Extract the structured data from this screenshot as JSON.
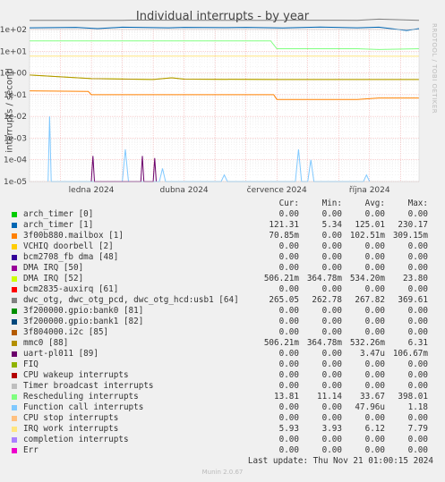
{
  "title": "Individual interrupts - by year",
  "side_note": "RRDTOOL / TOBI OETIKER",
  "footer": "Last update: Thu Nov 21 01:00:15 2024",
  "version": "Munin 2.0.67",
  "legend_headers": [
    "Cur:",
    "Min:",
    "Avg:",
    "Max:"
  ],
  "legend": [
    {
      "name": "arch_timer [0]",
      "color": "#00cc00",
      "cur": "0.00",
      "min": "0.00",
      "avg": "0.00",
      "max": "0.00"
    },
    {
      "name": "arch_timer [1]",
      "color": "#0066b3",
      "cur": "121.31",
      "min": "5.34",
      "avg": "125.01",
      "max": "230.17"
    },
    {
      "name": "3f00b880.mailbox [1]",
      "color": "#ff8000",
      "cur": "70.85m",
      "min": "0.00",
      "avg": "102.51m",
      "max": "309.15m"
    },
    {
      "name": "VCHIQ doorbell [2]",
      "color": "#ffcc00",
      "cur": "0.00",
      "min": "0.00",
      "avg": "0.00",
      "max": "0.00"
    },
    {
      "name": "bcm2708_fb dma [48]",
      "color": "#330099",
      "cur": "0.00",
      "min": "0.00",
      "avg": "0.00",
      "max": "0.00"
    },
    {
      "name": "DMA IRQ [50]",
      "color": "#990099",
      "cur": "0.00",
      "min": "0.00",
      "avg": "0.00",
      "max": "0.00"
    },
    {
      "name": "DMA IRQ [52]",
      "color": "#ccff00",
      "cur": "506.21m",
      "min": "364.78m",
      "avg": "534.20m",
      "max": "23.80"
    },
    {
      "name": "bcm2835-auxirq [61]",
      "color": "#ff0000",
      "cur": "0.00",
      "min": "0.00",
      "avg": "0.00",
      "max": "0.00"
    },
    {
      "name": "dwc_otg, dwc_otg_pcd, dwc_otg_hcd:usb1 [64]",
      "color": "#808080",
      "cur": "265.05",
      "min": "262.78",
      "avg": "267.82",
      "max": "369.61"
    },
    {
      "name": "3f200000.gpio:bank0 [81]",
      "color": "#008f00",
      "cur": "0.00",
      "min": "0.00",
      "avg": "0.00",
      "max": "0.00"
    },
    {
      "name": "3f200000.gpio:bank1 [82]",
      "color": "#00487d",
      "cur": "0.00",
      "min": "0.00",
      "avg": "0.00",
      "max": "0.00"
    },
    {
      "name": "3f804000.i2c [85]",
      "color": "#b35a00",
      "cur": "0.00",
      "min": "0.00",
      "avg": "0.00",
      "max": "0.00"
    },
    {
      "name": "mmc0 [88]",
      "color": "#b38f00",
      "cur": "506.21m",
      "min": "364.78m",
      "avg": "532.26m",
      "max": "6.31"
    },
    {
      "name": "uart-pl011 [89]",
      "color": "#6b006b",
      "cur": "0.00",
      "min": "0.00",
      "avg": "3.47u",
      "max": "106.67m"
    },
    {
      "name": "FIQ",
      "color": "#8fb300",
      "cur": "0.00",
      "min": "0.00",
      "avg": "0.00",
      "max": "0.00"
    },
    {
      "name": "CPU wakeup interrupts",
      "color": "#b30000",
      "cur": "0.00",
      "min": "0.00",
      "avg": "0.00",
      "max": "0.00"
    },
    {
      "name": "Timer broadcast interrupts",
      "color": "#bebebe",
      "cur": "0.00",
      "min": "0.00",
      "avg": "0.00",
      "max": "0.00"
    },
    {
      "name": "Rescheduling interrupts",
      "color": "#80ff80",
      "cur": "13.81",
      "min": "11.14",
      "avg": "33.67",
      "max": "398.01"
    },
    {
      "name": "Function call interrupts",
      "color": "#80c9ff",
      "cur": "0.00",
      "min": "0.00",
      "avg": "47.96u",
      "max": "1.18"
    },
    {
      "name": "CPU stop interrupts",
      "color": "#ffc080",
      "cur": "0.00",
      "min": "0.00",
      "avg": "0.00",
      "max": "0.00"
    },
    {
      "name": "IRQ work interrupts",
      "color": "#ffe680",
      "cur": "5.93",
      "min": "3.93",
      "avg": "6.12",
      "max": "7.79"
    },
    {
      "name": "completion interrupts",
      "color": "#aa80ff",
      "cur": "0.00",
      "min": "0.00",
      "avg": "0.00",
      "max": "0.00"
    },
    {
      "name": "Err",
      "color": "#ee00cc",
      "cur": "0.00",
      "min": "0.00",
      "avg": "0.00",
      "max": "0.00"
    }
  ],
  "chart_data": {
    "type": "line",
    "title": "Individual interrupts - by year",
    "ylabel": "interrupts / second",
    "yscale": "log",
    "ylim": [
      1e-05,
      100
    ],
    "yticks": [
      "1e-05",
      "1e-04",
      "1e-03",
      "1e-02",
      "1e-01",
      "1e+00",
      "1e+01",
      "1e+02"
    ],
    "xrange_months": [
      0,
      12.6
    ],
    "xticks": [
      {
        "label": "ledna 2024",
        "month": 2.0
      },
      {
        "label": "dubna 2024",
        "month": 5.0
      },
      {
        "label": "července 2024",
        "month": 8.0
      },
      {
        "label": "října 2024",
        "month": 11.0
      }
    ],
    "series": [
      {
        "name": "dwc_otg, dwc_otg_pcd, dwc_otg_hcd:usb1 [64]",
        "color": "#808080",
        "points": [
          [
            0,
            265
          ],
          [
            3,
            265
          ],
          [
            3.3,
            270
          ],
          [
            6,
            265
          ],
          [
            8,
            265
          ],
          [
            8.2,
            268
          ],
          [
            10.6,
            265
          ],
          [
            11.3,
            300
          ],
          [
            12.6,
            265
          ]
        ]
      },
      {
        "name": "arch_timer [1]",
        "color": "#0066b3",
        "points": [
          [
            0,
            120
          ],
          [
            1.5,
            125
          ],
          [
            2.2,
            110
          ],
          [
            3,
            128
          ],
          [
            4.5,
            120
          ],
          [
            5,
            126
          ],
          [
            6.3,
            122
          ],
          [
            7,
            125
          ],
          [
            8.2,
            118
          ],
          [
            9.4,
            130
          ],
          [
            10.6,
            120
          ],
          [
            11.3,
            128
          ],
          [
            12.2,
            90
          ],
          [
            12.6,
            110
          ]
        ]
      },
      {
        "name": "Rescheduling interrupts",
        "color": "#80ff80",
        "points": [
          [
            0,
            30
          ],
          [
            7.8,
            30
          ],
          [
            8,
            13
          ],
          [
            10.6,
            13
          ],
          [
            11.3,
            12
          ],
          [
            12.6,
            13
          ]
        ]
      },
      {
        "name": "IRQ work interrupts",
        "color": "#ffe680",
        "points": [
          [
            0,
            6
          ],
          [
            10.6,
            6
          ],
          [
            11.3,
            5.9
          ],
          [
            12.6,
            5.9
          ]
        ]
      },
      {
        "name": "DMA IRQ [52]",
        "color": "#ccff00",
        "points": [
          [
            0,
            0.8
          ],
          [
            2,
            0.55
          ],
          [
            4,
            0.5
          ],
          [
            4.6,
            0.6
          ],
          [
            5,
            0.52
          ],
          [
            8,
            0.5
          ],
          [
            10.6,
            0.5
          ],
          [
            11.3,
            0.5
          ],
          [
            12.6,
            0.5
          ]
        ]
      },
      {
        "name": "mmc0 [88]",
        "color": "#b38f00",
        "points": [
          [
            0,
            0.8
          ],
          [
            2,
            0.55
          ],
          [
            4,
            0.5
          ],
          [
            4.6,
            0.6
          ],
          [
            5,
            0.52
          ],
          [
            8,
            0.5
          ],
          [
            10.6,
            0.5
          ],
          [
            11.3,
            0.5
          ],
          [
            12.6,
            0.5
          ]
        ]
      },
      {
        "name": "3f00b880.mailbox [1]",
        "color": "#ff8000",
        "points": [
          [
            0,
            0.15
          ],
          [
            1.9,
            0.14
          ],
          [
            2,
            0.1
          ],
          [
            7.9,
            0.1
          ],
          [
            8,
            0.06
          ],
          [
            10.6,
            0.06
          ],
          [
            11.3,
            0.07
          ],
          [
            12.6,
            0.07
          ]
        ]
      },
      {
        "name": "Function call interrupts",
        "color": "#80c9ff",
        "points": [
          [
            0.6,
            1e-05
          ],
          [
            0.65,
            0.01
          ],
          [
            0.7,
            1e-05
          ],
          [
            3.0,
            1e-05
          ],
          [
            3.1,
            0.0003
          ],
          [
            3.2,
            1e-05
          ],
          [
            4.2,
            1e-05
          ],
          [
            4.3,
            4e-05
          ],
          [
            4.4,
            1e-05
          ],
          [
            6.2,
            1e-05
          ],
          [
            6.3,
            2e-05
          ],
          [
            6.4,
            1e-05
          ],
          [
            8.6,
            1e-05
          ],
          [
            8.7,
            0.0003
          ],
          [
            8.8,
            1e-05
          ],
          [
            9.0,
            1e-05
          ],
          [
            9.1,
            0.0001
          ],
          [
            9.2,
            1e-05
          ],
          [
            10.8,
            1e-05
          ],
          [
            10.9,
            2e-05
          ],
          [
            11.0,
            1e-05
          ]
        ]
      },
      {
        "name": "uart-pl011 [89]",
        "color": "#6b006b",
        "points": [
          [
            2.0,
            1e-05
          ],
          [
            2.05,
            0.00015
          ],
          [
            2.1,
            1e-05
          ],
          [
            3.6,
            1e-05
          ],
          [
            3.65,
            0.00015
          ],
          [
            3.7,
            1e-05
          ],
          [
            4.0,
            1e-05
          ],
          [
            4.05,
            0.00012
          ],
          [
            4.1,
            1e-05
          ]
        ]
      }
    ]
  }
}
